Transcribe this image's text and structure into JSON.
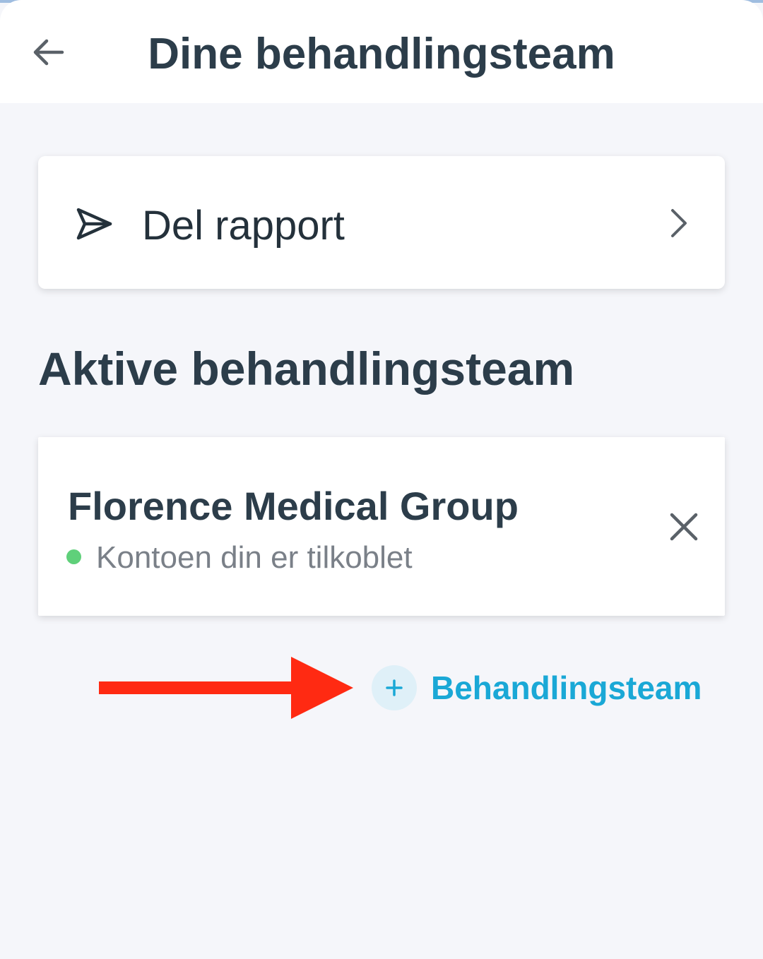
{
  "header": {
    "title": "Dine behandlingsteam",
    "back_icon": "arrow-left-icon"
  },
  "share": {
    "label": "Del rapport",
    "icon": "paper-plane-icon",
    "chevron_icon": "chevron-right-icon"
  },
  "active_section": {
    "title": "Aktive behandlingsteam"
  },
  "teams": [
    {
      "name": "Florence Medical Group",
      "status": "Kontoen din er tilkoblet",
      "status_color": "#5fd07a",
      "remove_icon": "close-icon"
    }
  ],
  "add_team": {
    "label": "Behandlingsteam",
    "icon": "plus-icon",
    "color": "#1aa8d6"
  },
  "annotation": {
    "icon": "red-arrow-right-icon",
    "color": "#ff2a12"
  },
  "colors": {
    "background": "#f5f6fa",
    "text_dark": "#2c3d4a",
    "text_muted": "#7a8088"
  }
}
